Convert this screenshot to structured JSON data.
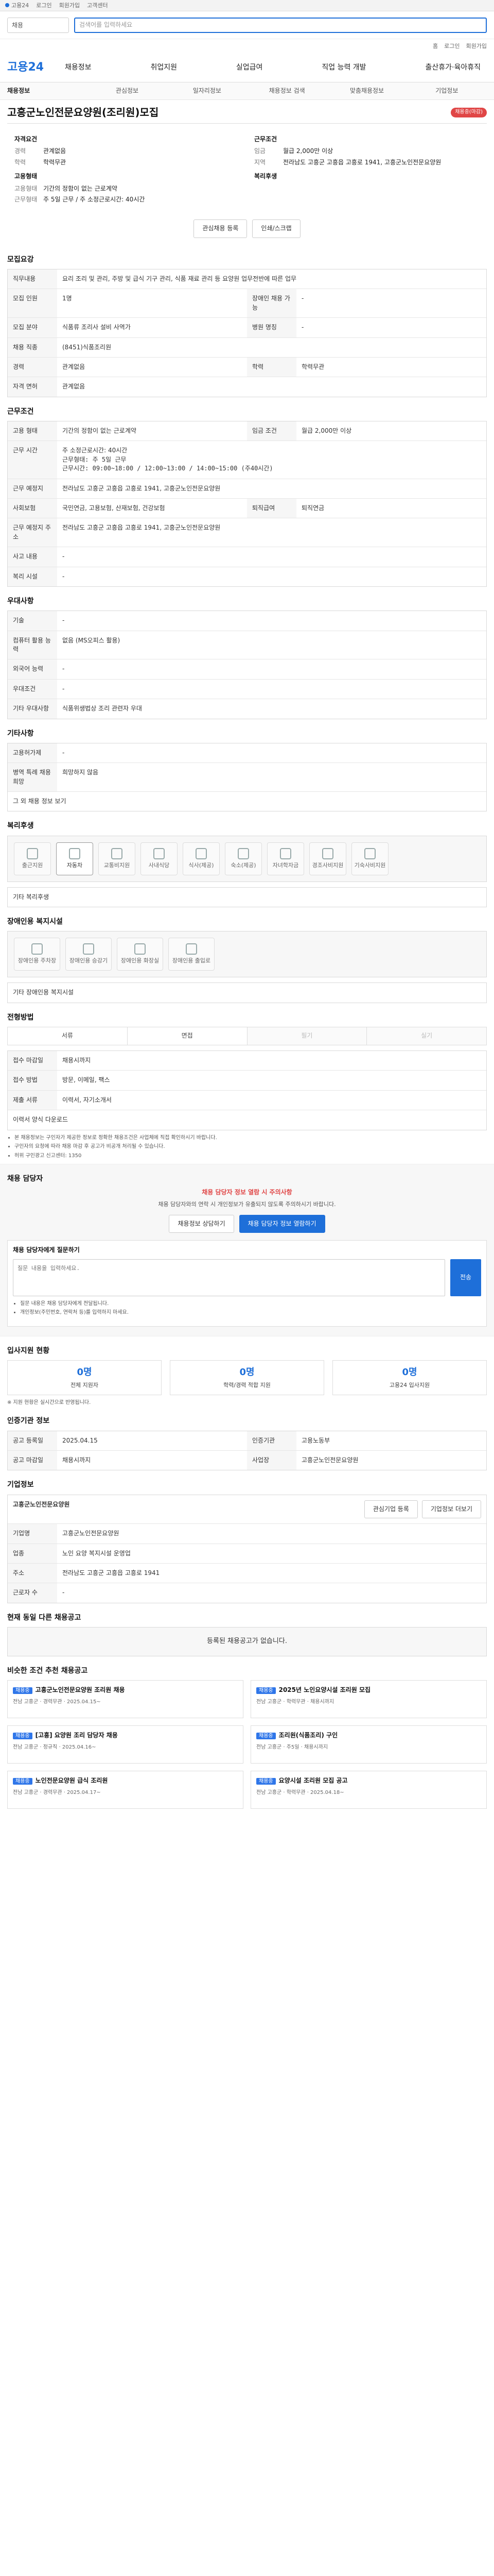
{
  "topbar": {
    "title": "고용24",
    "links": [
      "로그인",
      "회원가입",
      "고객센터"
    ]
  },
  "search": {
    "select_value": "채용",
    "placeholder": "검색어를 입력하세요"
  },
  "util_links": [
    "홈",
    "로그인",
    "회원가입"
  ],
  "brand": {
    "logo": "고용24"
  },
  "gnb": {
    "items": [
      "채용정보",
      "취업지원",
      "실업급여",
      "직업 능력 개발",
      "출산휴가·육아휴직"
    ]
  },
  "subnav": {
    "items": [
      "채용정보",
      "관심정보",
      "일자리정보",
      "채용정보 검색",
      "맞춤채용정보",
      "기업정보"
    ]
  },
  "job": {
    "title": "고흥군노인전문요양원(조리원)모집",
    "status_badge": "채용중(마감)"
  },
  "summary": {
    "left_title": "자격요건",
    "left": [
      {
        "k": "경력",
        "v": "관계없음"
      },
      {
        "k": "학력",
        "v": "학력무관"
      }
    ],
    "right_title": "근무조건",
    "right": [
      {
        "k": "임금",
        "v": "월급 2,000만 이상"
      },
      {
        "k": "지역",
        "v": "전라남도 고흥군 고흥읍 고흥로 1941, 고흥군노인전문요양원"
      }
    ],
    "left2_title": "고용형태",
    "left2": [
      {
        "k": "고용형태",
        "v": "기간의 정함이 없는 근로계약"
      },
      {
        "k": "근무형태",
        "v": "주 5일 근무 / 주 소정근로시간: 40시간"
      }
    ],
    "right2_title": "복리후생",
    "right2": [
      {
        "k": "",
        "v": ""
      }
    ]
  },
  "actions": {
    "interest": "관심채용 등록",
    "print": "인쇄/스크랩"
  },
  "sections": {
    "recruit_title": "모집요강",
    "conditions_title": "근무조건",
    "pref_title": "우대사항",
    "other_title": "기타사항",
    "welfare_title": "복리후생",
    "disabled_title": "장애인용 복지시설",
    "process_title": "전형방법",
    "contact_title": "채용 담당자",
    "status_title": "입사지원 현황",
    "period_title": "인증기관 정보",
    "company_title": "기업정보",
    "related_title": "현재 동일 다른 채용공고",
    "similar_title": "비슷한 조건 추천 채용공고"
  },
  "recruit": {
    "job_desc_label": "직무내용",
    "job_desc": "요리 조리 및 관리, 주방 및 급식 기구 관리, 식품 재료 관리 등 요양원 업무전반에 따른 업무",
    "rows": [
      {
        "k": "모집 인원",
        "v": "1명",
        "k2": "장애인 채용 가능",
        "v2": "-"
      },
      {
        "k": "모집 분야",
        "v": "식품류 조리사 설비 사역가",
        "k2": "병원 명칭",
        "v2": "-"
      },
      {
        "k": "채용 직종",
        "v": "(8451)식품조리원",
        "k2": "",
        "v2": ""
      },
      {
        "k": "경력",
        "v": "관계없음",
        "k2": "학력",
        "v2": "학력무관"
      },
      {
        "k": "자격 면허",
        "v": "관계없음",
        "k2": "",
        "v2": ""
      }
    ]
  },
  "conditions": {
    "rows": [
      {
        "k": "고용 형태",
        "v": "기간의 정함이 없는 근로계약",
        "k2": "임금 조건",
        "v2": "월급 2,000만 이상"
      },
      {
        "k": "근무 시간",
        "v": "주 소정근로시간: 40시간",
        "k2": "",
        "v2": ""
      },
      {
        "k": "근무 예정지",
        "v": "전라남도 고흥군 고흥읍 고흥로 1941, 고흥군노인전문요양원",
        "k2": "",
        "v2": ""
      },
      {
        "k": "사회보험",
        "v": "국민연금, 고용보험, 산재보험, 건강보험",
        "k2": "퇴직급여",
        "v2": "퇴직연금"
      },
      {
        "k": "근무 예정지 주소",
        "v": "전라남도 고흥군 고흥읍 고흥로 1941, 고흥군노인전문요양원",
        "k2": "",
        "v2": ""
      },
      {
        "k": "사고 내용",
        "v": "-",
        "k2": "",
        "v2": ""
      },
      {
        "k": "복리 시설",
        "v": "-",
        "k2": "",
        "v2": ""
      }
    ],
    "time_detail_1": "근무형태: 주 5일 근무",
    "time_detail_2": "근무시간: 09:00~18:00 / 12:00~13:00 / 14:00~15:00 (주40시간)"
  },
  "pref": {
    "rows": [
      {
        "k": "기술",
        "v": "-"
      },
      {
        "k": "컴퓨터 활용 능력",
        "v": "없음 (MS오피스 활용)"
      },
      {
        "k": "외국어 능력",
        "v": "-"
      },
      {
        "k": "우대조건",
        "v": "-"
      },
      {
        "k": "기타 우대사항",
        "v": "식품위생법상 조리 관련자 우대"
      }
    ]
  },
  "other": {
    "rows": [
      {
        "k": "고용허가제",
        "v": "-"
      },
      {
        "k": "병역 특례 채용 희망",
        "v": "희망하지 않음"
      }
    ],
    "more_label": "그 외 채용 정보 보기"
  },
  "welfare": {
    "chips": [
      "출근지원",
      "자동차",
      "교통비지원",
      "사내식당",
      "식사(제공)",
      "숙소(제공)",
      "자녀학자금",
      "경조사비지원",
      "기숙사비지원"
    ],
    "more_label": "기타 복리후생"
  },
  "disabled": {
    "chips": [
      "장애인용 주차장",
      "장애인용 승강기",
      "장애인용 화장실",
      "장애인용 출입로"
    ],
    "more_label": "기타 장애인용 복지시설"
  },
  "process": {
    "tabs": [
      "서류",
      "면접",
      "필기",
      "실기"
    ],
    "rows": [
      {
        "k": "접수 마감일",
        "v": "채용시까지"
      },
      {
        "k": "접수 방법",
        "v": "방문, 이메일, 팩스"
      },
      {
        "k": "제출 서류",
        "v": "이력서, 자기소개서"
      }
    ],
    "apply_hint": "이력서 양식 다운로드",
    "notes": [
      "본 채용정보는 구인자가 제공한 정보로 정확한 채용조건은 사업체에 직접 확인하시기 바랍니다.",
      "구인자의 요청에 따라 채용 마감 후 공고가 비공개 처리될 수 있습니다.",
      "허위 구인광고 신고센터: 1350"
    ]
  },
  "contact": {
    "alert_1": "채용 담당자 정보 열람 시 주의사항",
    "alert_2": "채용 담당자와의 연락 시 개인정보가 유출되지 않도록 주의하시기 바랍니다.",
    "btn_left": "채용정보 상담하기",
    "btn_right": "채용 담당자 정보 열람하기",
    "talk_title": "채용 담당자에게 질문하기",
    "talk_placeholder": "질문 내용을 입력하세요.",
    "talk_send": "전송",
    "notes": [
      "질문 내용은 채용 담당자에게 전달됩니다.",
      "개인정보(주민번호, 연락처 등)를 입력하지 마세요."
    ]
  },
  "status": {
    "cards": [
      {
        "num": "0명",
        "lbl": "전체 지원자"
      },
      {
        "num": "0명",
        "lbl": "학력/경력 적합 지원"
      },
      {
        "num": "0명",
        "lbl": "고용24 입사지원"
      }
    ],
    "note": "※ 지원 현황은 실시간으로 반영됩니다."
  },
  "period": {
    "rows": [
      {
        "k": "공고 등록일",
        "v": "2025.04.15",
        "k2": "인증기관",
        "v2": "고용노동부"
      },
      {
        "k": "공고 마감일",
        "v": "채용시까지",
        "k2": "사업장",
        "v2": "고흥군노인전문요양원"
      }
    ]
  },
  "company": {
    "name": "고흥군노인전문요양원",
    "rows": [
      {
        "k": "기업명",
        "v": "고흥군노인전문요양원"
      },
      {
        "k": "업종",
        "v": "노인 요양 복지시설 운영업"
      },
      {
        "k": "주소",
        "v": "전라남도 고흥군 고흥읍 고흥로 1941"
      },
      {
        "k": "근로자 수",
        "v": "-"
      }
    ],
    "btns": [
      "관심기업 등록",
      "기업정보 더보기"
    ]
  },
  "related": {
    "empty": "등록된 채용공고가 없습니다."
  },
  "similar": {
    "items": [
      {
        "tag": "채용중",
        "title": "고흥군노인전문요양원 조리원 채용",
        "meta": "전남 고흥군 · 경력무관 · 2025.04.15~"
      },
      {
        "tag": "채용중",
        "title": "2025년 노인요양시설 조리원 모집",
        "meta": "전남 고흥군 · 학력무관 · 채용시까지"
      },
      {
        "tag": "채용중",
        "title": "[고흥] 요양원 조리 담당자 채용",
        "meta": "전남 고흥군 · 정규직 · 2025.04.16~"
      },
      {
        "tag": "채용중",
        "title": "조리원(식품조리) 구인",
        "meta": "전남 고흥군 · 주5일 · 채용시까지"
      },
      {
        "tag": "채용중",
        "title": "노인전문요양원 급식 조리원",
        "meta": "전남 고흥군 · 경력무관 · 2025.04.17~"
      },
      {
        "tag": "채용중",
        "title": "요양시설 조리원 모집 공고",
        "meta": "전남 고흥군 · 학력무관 · 2025.04.18~"
      }
    ]
  }
}
